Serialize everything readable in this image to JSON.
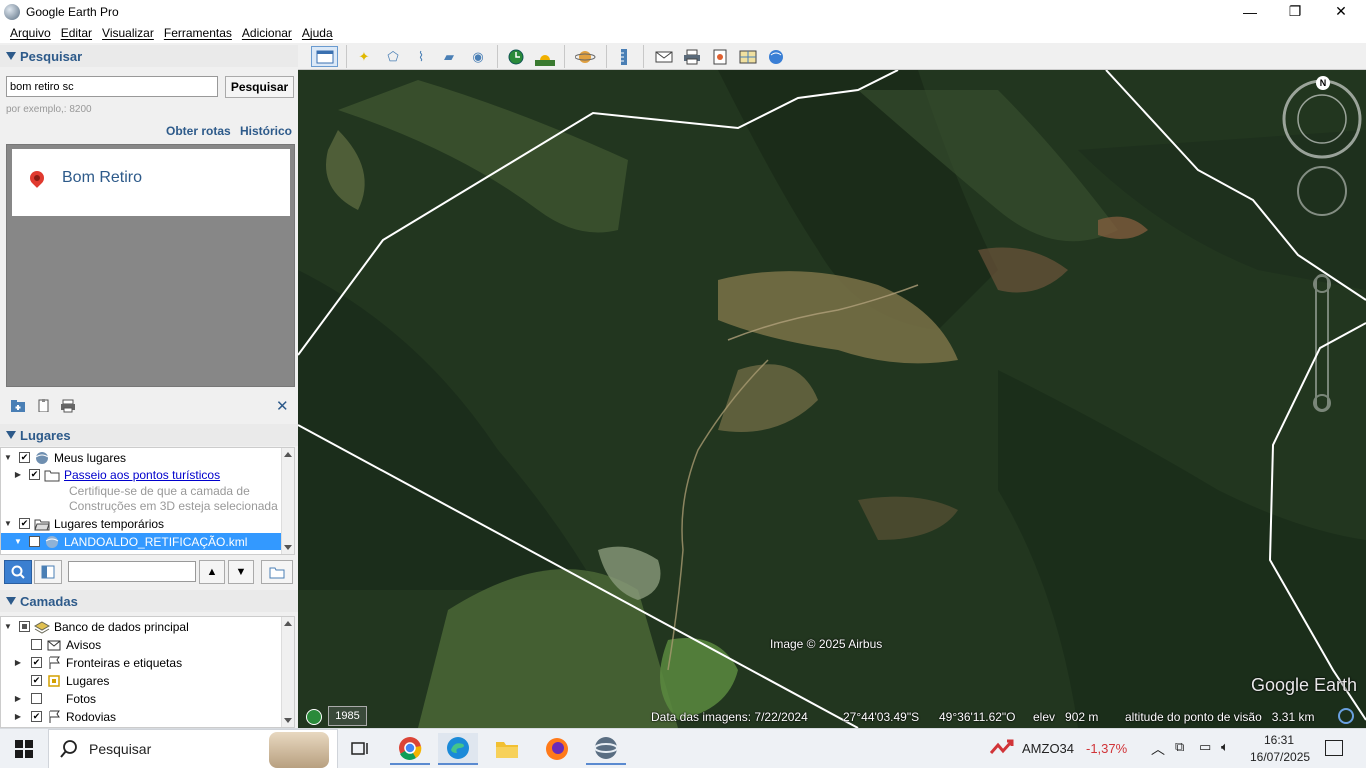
{
  "window": {
    "title": "Google Earth Pro",
    "minimize_glyph": "—",
    "maximize_glyph": "❐",
    "close_glyph": "✕"
  },
  "menu": [
    "Arquivo",
    "Editar",
    "Visualizar",
    "Ferramentas",
    "Adicionar",
    "Ajuda"
  ],
  "search": {
    "header": "Pesquisar",
    "input_value": "bom retiro sc",
    "button_label": "Pesquisar",
    "example": "por exemplo,: 8200",
    "routes_link": "Obter rotas",
    "history_link": "Histórico",
    "result": "Bom Retiro",
    "close_glyph": "✕"
  },
  "places": {
    "header": "Lugares",
    "items": {
      "my_places": "Meus lugares",
      "tour": "Passeio aos pontos turísticos",
      "note_line1": "Certifique-se de que a camada de",
      "note_line2": "Construções em 3D esteja selecionada",
      "temp_places": "Lugares temporários",
      "kml": "LANDOALDO_RETIFICAÇÃO.kml"
    },
    "search_value": ""
  },
  "layers": {
    "header": "Camadas",
    "items": {
      "main_db": "Banco de dados principal",
      "notices": "Avisos",
      "borders": "Fronteiras e etiquetas",
      "places": "Lugares",
      "photos": "Fotos",
      "roads": "Rodovias"
    }
  },
  "map": {
    "copyright": "Image © 2025 Airbus",
    "brand": "Google Earth",
    "year_badge": "1985",
    "imagery_date": "Data das imagens: 7/22/2024",
    "lat": "27°44'03.49\"S",
    "lon": "49°36'11.62\"O",
    "elev": "elev   902 m",
    "eye_alt": "altitude do ponto de visão   3.31 km",
    "compass_n": "N"
  },
  "taskbar": {
    "search_label": "Pesquisar",
    "stock_symbol": "AMZO34",
    "stock_change": "-1,37%",
    "time": "16:31",
    "date": "16/07/2025"
  },
  "colors": {
    "header_blue": "#2d5a8a",
    "selection": "#3399ff",
    "boundary": "#ffffff",
    "stock_red": "#d13438"
  }
}
